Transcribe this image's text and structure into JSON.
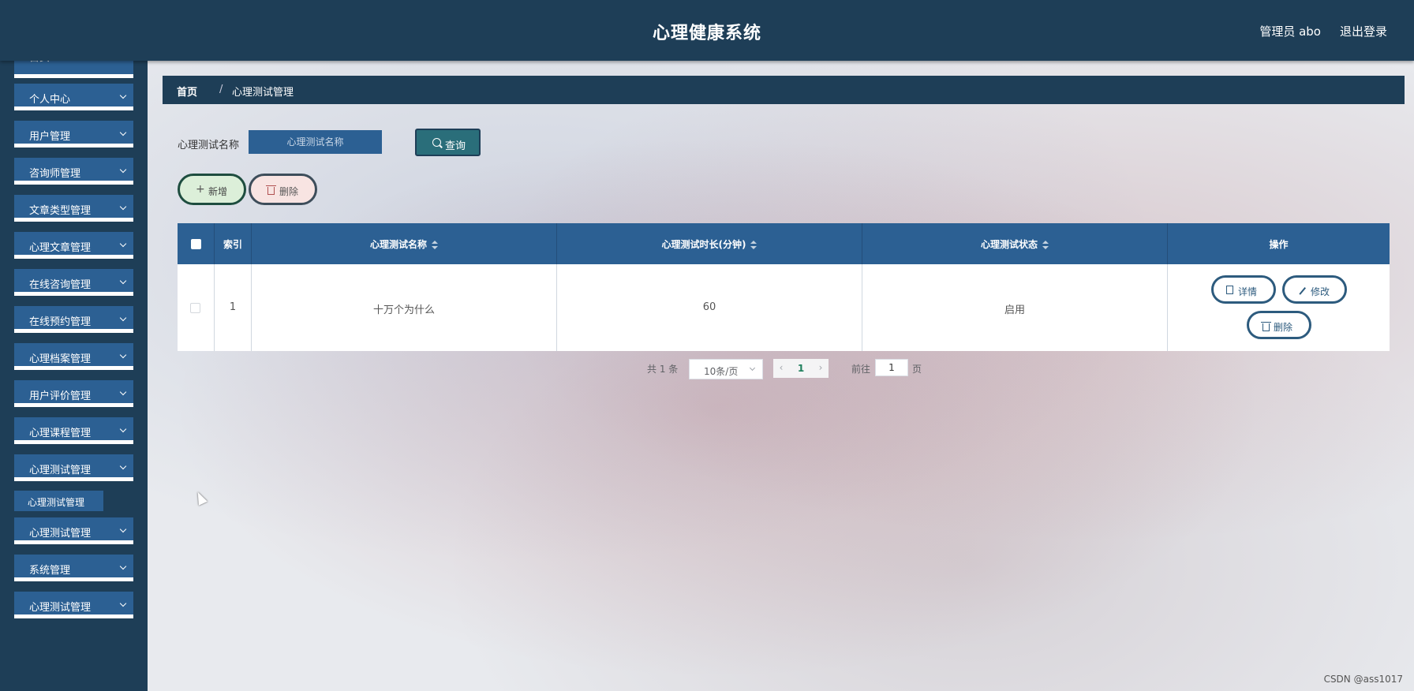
{
  "header": {
    "title": "心理健康系统",
    "admin": "管理员 abo",
    "logout": "退出登录"
  },
  "sidebar": {
    "items": [
      {
        "label": "首页"
      },
      {
        "label": "个人中心"
      },
      {
        "label": "用户管理"
      },
      {
        "label": "咨询师管理"
      },
      {
        "label": "文章类型管理"
      },
      {
        "label": "心理文章管理"
      },
      {
        "label": "在线咨询管理"
      },
      {
        "label": "在线预约管理"
      },
      {
        "label": "心理档案管理"
      },
      {
        "label": "用户评价管理"
      },
      {
        "label": "心理课程管理"
      },
      {
        "label": "心理测试管理"
      },
      {
        "label": "心理测试管理"
      },
      {
        "label": "系统管理"
      },
      {
        "label": "心理测试管理"
      }
    ],
    "sub_item": "心理测试管理"
  },
  "breadcrumb": {
    "home": "首页",
    "separator": "/",
    "current": "心理测试管理"
  },
  "search": {
    "label": "心理测试名称",
    "placeholder": "心理测试名称",
    "button": "查询"
  },
  "actions": {
    "add": "新增",
    "delete": "删除"
  },
  "table": {
    "headers": [
      "索引",
      "心理测试名称",
      "心理测试时长(分钟)",
      "心理测试状态",
      "操作"
    ],
    "rows": [
      {
        "index": "1",
        "name": "十万个为什么",
        "duration": "60",
        "status": "启用"
      }
    ],
    "row_actions": {
      "detail": "详情",
      "edit": "修改",
      "delete": "删除"
    }
  },
  "pagination": {
    "total": "共 1 条",
    "page_size": "10条/页",
    "prev": "‹",
    "current": "1",
    "next": "›",
    "goto_prefix": "前往",
    "goto_value": "1",
    "goto_suffix": "页"
  },
  "watermark": "CSDN @ass1017",
  "colors": {
    "header_bg": "#1e3e57",
    "menu_bg": "#2c6093",
    "search_btn": "#2a6e7a"
  }
}
